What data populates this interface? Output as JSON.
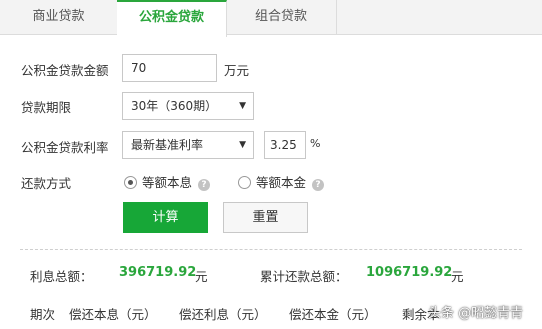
{
  "tabs": [
    {
      "label": "商业贷款"
    },
    {
      "label": "公积金贷款"
    },
    {
      "label": "组合贷款"
    }
  ],
  "active_tab": "公积金贷款",
  "accent_color": "#17a737",
  "form": {
    "amount_label": "公积金贷款金额",
    "amount_value": "70",
    "amount_unit": "万元",
    "term_label": "贷款期限",
    "term_value": "30年（360期）",
    "rate_label": "公积金贷款利率",
    "rate_type_value": "最新基准利率",
    "rate_value": "3.25",
    "rate_unit": "%",
    "method_label": "还款方式",
    "method_options": [
      {
        "label": "等额本息",
        "selected": true
      },
      {
        "label": "等额本金",
        "selected": false
      }
    ],
    "calculate_label": "计算",
    "reset_label": "重置"
  },
  "summary": {
    "interest_label": "利息总额：",
    "interest_value": "396719.92",
    "interest_unit": "元",
    "total_label": "累计还款总额：",
    "total_value": "1096719.92",
    "total_unit": "元"
  },
  "table_headers": [
    "期次",
    "偿还本息（元）",
    "偿还利息（元）",
    "偿还本金（元）",
    "剩余本"
  ],
  "watermark": "头条 @昭懿青青"
}
